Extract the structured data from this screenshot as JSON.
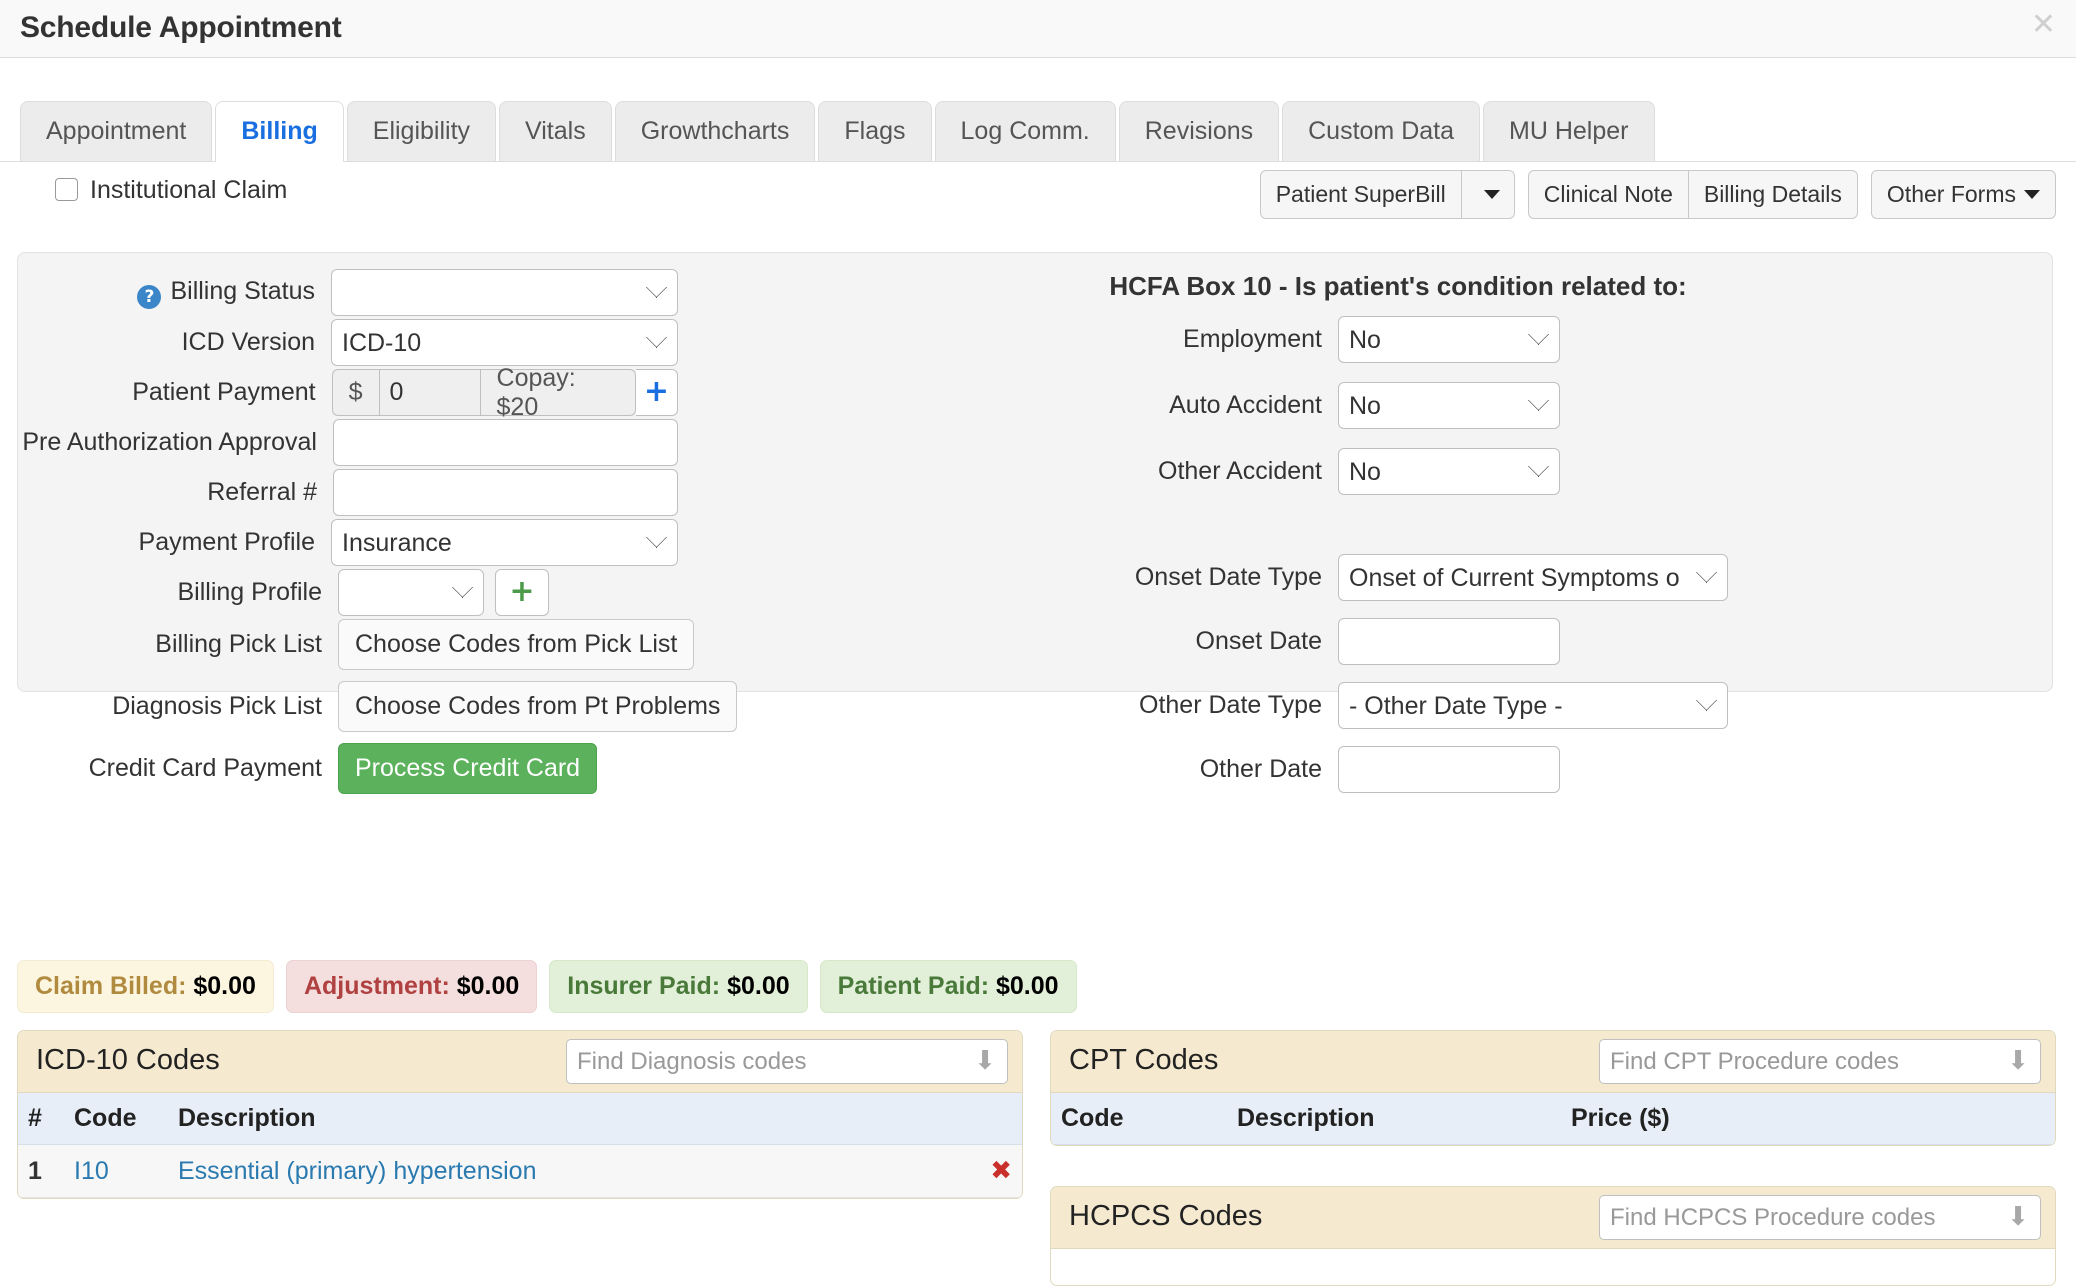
{
  "window": {
    "title": "Schedule Appointment",
    "close_icon": "close-icon"
  },
  "tabs": [
    {
      "label": "Appointment",
      "active": false
    },
    {
      "label": "Billing",
      "active": true
    },
    {
      "label": "Eligibility",
      "active": false
    },
    {
      "label": "Vitals",
      "active": false
    },
    {
      "label": "Growthcharts",
      "active": false
    },
    {
      "label": "Flags",
      "active": false
    },
    {
      "label": "Log Comm.",
      "active": false
    },
    {
      "label": "Revisions",
      "active": false
    },
    {
      "label": "Custom Data",
      "active": false
    },
    {
      "label": "MU Helper",
      "active": false
    }
  ],
  "toolbar": {
    "institutional_claim_label": "Institutional Claim",
    "institutional_claim_checked": false,
    "patient_superbill_label": "Patient SuperBill",
    "clinical_note_label": "Clinical Note",
    "billing_details_label": "Billing Details",
    "other_forms_label": "Other Forms"
  },
  "form_left": {
    "billing_status_label": "Billing Status",
    "billing_status_value": "",
    "icd_version_label": "ICD Version",
    "icd_version_value": "ICD-10",
    "patient_payment_label": "Patient Payment",
    "currency_symbol": "$",
    "patient_payment_value": "0",
    "copay_label": "Copay: $20",
    "add_payment_icon": "+",
    "pre_auth_label": "Pre Authorization Approval",
    "pre_auth_value": "",
    "referral_label": "Referral #",
    "referral_value": "",
    "payment_profile_label": "Payment Profile",
    "payment_profile_value": "Insurance",
    "billing_profile_label": "Billing Profile",
    "billing_profile_value": "",
    "add_billing_profile_icon": "+",
    "billing_pick_list_label": "Billing Pick List",
    "billing_pick_list_button": "Choose Codes from Pick List",
    "diagnosis_pick_list_label": "Diagnosis Pick List",
    "diagnosis_pick_list_button": "Choose Codes from Pt Problems",
    "credit_card_label": "Credit Card Payment",
    "credit_card_button": "Process Credit Card"
  },
  "form_right": {
    "hcfa_title": "HCFA Box 10 - Is patient's condition related to:",
    "employment_label": "Employment",
    "employment_value": "No",
    "auto_accident_label": "Auto Accident",
    "auto_accident_value": "No",
    "other_accident_label": "Other Accident",
    "other_accident_value": "No",
    "onset_date_type_label": "Onset Date Type",
    "onset_date_type_value": "Onset of Current Symptoms o",
    "onset_date_label": "Onset Date",
    "onset_date_value": "",
    "other_date_type_label": "Other Date Type",
    "other_date_type_value": "- Other Date Type -",
    "other_date_label": "Other Date",
    "other_date_value": ""
  },
  "summary": [
    {
      "label": "Claim Billed:",
      "amount": "$0.00",
      "style": "billed"
    },
    {
      "label": "Adjustment:",
      "amount": "$0.00",
      "style": "adjust"
    },
    {
      "label": "Insurer Paid:",
      "amount": "$0.00",
      "style": "insurer"
    },
    {
      "label": "Patient Paid:",
      "amount": "$0.00",
      "style": "patient"
    }
  ],
  "icd_panel": {
    "title": "ICD-10 Codes",
    "search_placeholder": "Find Diagnosis codes",
    "search_value": "",
    "columns": [
      "#",
      "Code",
      "Description"
    ],
    "rows": [
      {
        "num": "1",
        "code": "I10",
        "description": "Essential (primary) hypertension",
        "delete_icon": "✖"
      }
    ]
  },
  "cpt_panel": {
    "title": "CPT Codes",
    "search_placeholder": "Find CPT Procedure codes",
    "search_value": "",
    "columns": [
      "Code",
      "Description",
      "Price ($)"
    ],
    "rows": []
  },
  "hcpcs_panel": {
    "title": "HCPCS Codes",
    "search_placeholder": "Find HCPCS Procedure codes",
    "search_value": ""
  },
  "colors": {
    "accent": "#1a6fe0",
    "green": "#5cb25c",
    "panel_header": "#f5ead0"
  }
}
